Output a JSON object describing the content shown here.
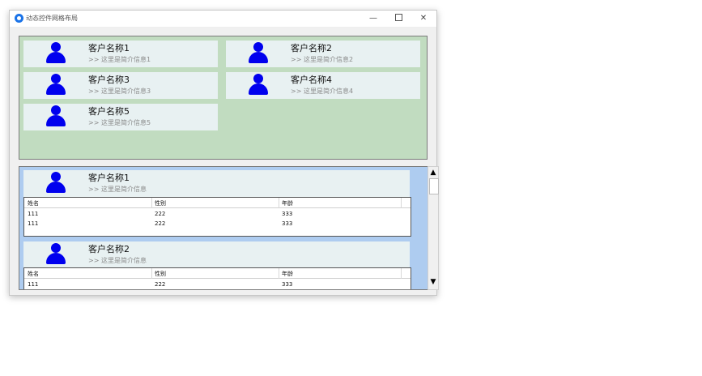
{
  "window": {
    "title": "动态控件网格布局",
    "controls": {
      "minimize": "—",
      "close": "✕"
    }
  },
  "top_cards": [
    {
      "name": "客户名称1",
      "intro": ">> 这里是简介信息1"
    },
    {
      "name": "客户名称2",
      "intro": ">> 这里是简介信息2"
    },
    {
      "name": "客户名称3",
      "intro": ">> 这里是简介信息3"
    },
    {
      "name": "客户名称4",
      "intro": ">> 这里是简介信息4"
    },
    {
      "name": "客户名称5",
      "intro": ">> 这里是简介信息5"
    }
  ],
  "list_items": [
    {
      "name": "客户名称1",
      "intro": ">> 这里是简介信息",
      "columns": [
        "姓名",
        "性别",
        "年龄"
      ],
      "rows": [
        [
          "111",
          "222",
          "333"
        ],
        [
          "111",
          "222",
          "333"
        ]
      ]
    },
    {
      "name": "客户名称2",
      "intro": ">> 这里是简介信息",
      "columns": [
        "姓名",
        "性别",
        "年龄"
      ],
      "rows": [
        [
          "111",
          "222",
          "333"
        ]
      ]
    }
  ],
  "scrollbar": {
    "up_arrow": "▲",
    "down_arrow": "▼"
  },
  "colors": {
    "top_panel_bg": "#c1dcc0",
    "bottom_panel_bg": "#aeccf0",
    "card_bg": "#e8f1f2",
    "avatar": "#0000ee"
  },
  "icons": {
    "app": "app-logo-icon",
    "avatar": "person-icon"
  }
}
